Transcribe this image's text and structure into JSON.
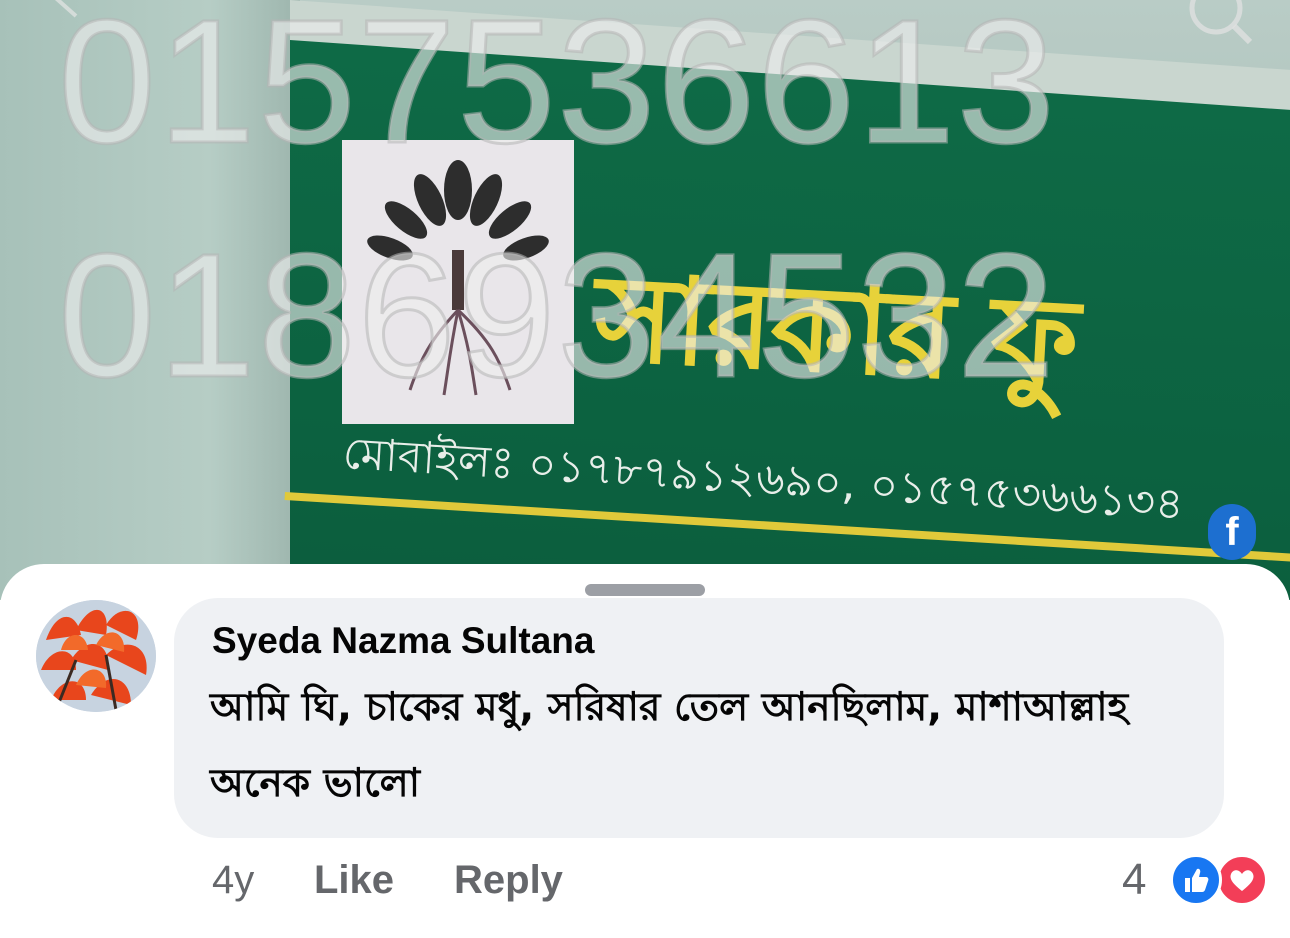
{
  "video_frame": {
    "overlay_numbers": [
      "0157536613",
      "0186934532"
    ],
    "sign_title": "সারকার ফু",
    "sign_mobile": "মোবাইলঃ ০১৭৮৭৯১২৬৯০, ০১৫৭৫৩৬৬১৩৪",
    "sign_fb": "f",
    "colors": {
      "board": "#0b5c3c",
      "title": "#e7d23a"
    }
  },
  "comment": {
    "author": "Syeda Nazma Sultana",
    "text": "আমি ঘি, চাকের মধু, সরিষার তেল আনছিলাম, মাশাআল্লাহ অনেক ভালো",
    "time": "4y",
    "like_label": "Like",
    "reply_label": "Reply",
    "reaction_count": "4",
    "reactions": [
      "like-icon",
      "love-icon"
    ],
    "avatar": "flower-avatar"
  },
  "colors": {
    "bubble": "#eff1f4",
    "secondary_text": "#65676b",
    "like_blue": "#1877f2",
    "love_red": "#f33e58"
  }
}
